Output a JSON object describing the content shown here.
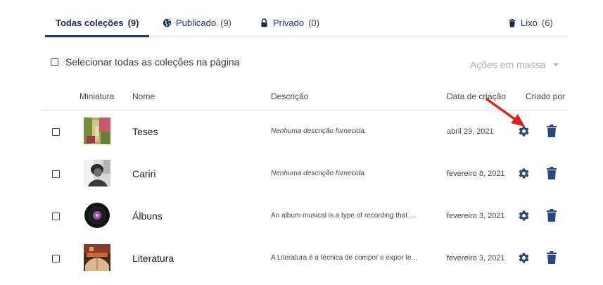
{
  "tabs": [
    {
      "label": "Todas coleções",
      "count": "(9)",
      "icon": ""
    },
    {
      "label": "Publicado",
      "count": "(9)",
      "icon": "globe-icon"
    },
    {
      "label": "Privado",
      "count": "(0)",
      "icon": "lock-icon"
    },
    {
      "label": "Lixo",
      "count": "(6)",
      "icon": "trash-icon"
    }
  ],
  "select_all_label": "Selecionar todas as coleções na página",
  "bulk_actions_label": "Ações em massa",
  "columns": {
    "thumbnail": "Miniatura",
    "name": "Nome",
    "description": "Descrição",
    "created_date": "Data de criação",
    "created_by": "Criado por"
  },
  "rows": [
    {
      "name": "Teses",
      "description": "Nenhuma descrição fornecida.",
      "date": "abril 29, 2021"
    },
    {
      "name": "Cariri",
      "description": "Nenhuma descrição fornecida.",
      "date": "fevereiro 8, 2021"
    },
    {
      "name": "Álbuns",
      "description": "An album musical is a type of recording that ...",
      "date": "fevereiro 3, 2021"
    },
    {
      "name": "Literatura",
      "description": "A Literatura é a técnica de compor e expor te...",
      "date": "fevereiro 3, 2021"
    }
  ],
  "colors": {
    "accent": "#1d3a63",
    "icon": "#2b4a7a",
    "annotation_arrow": "#e02020"
  }
}
